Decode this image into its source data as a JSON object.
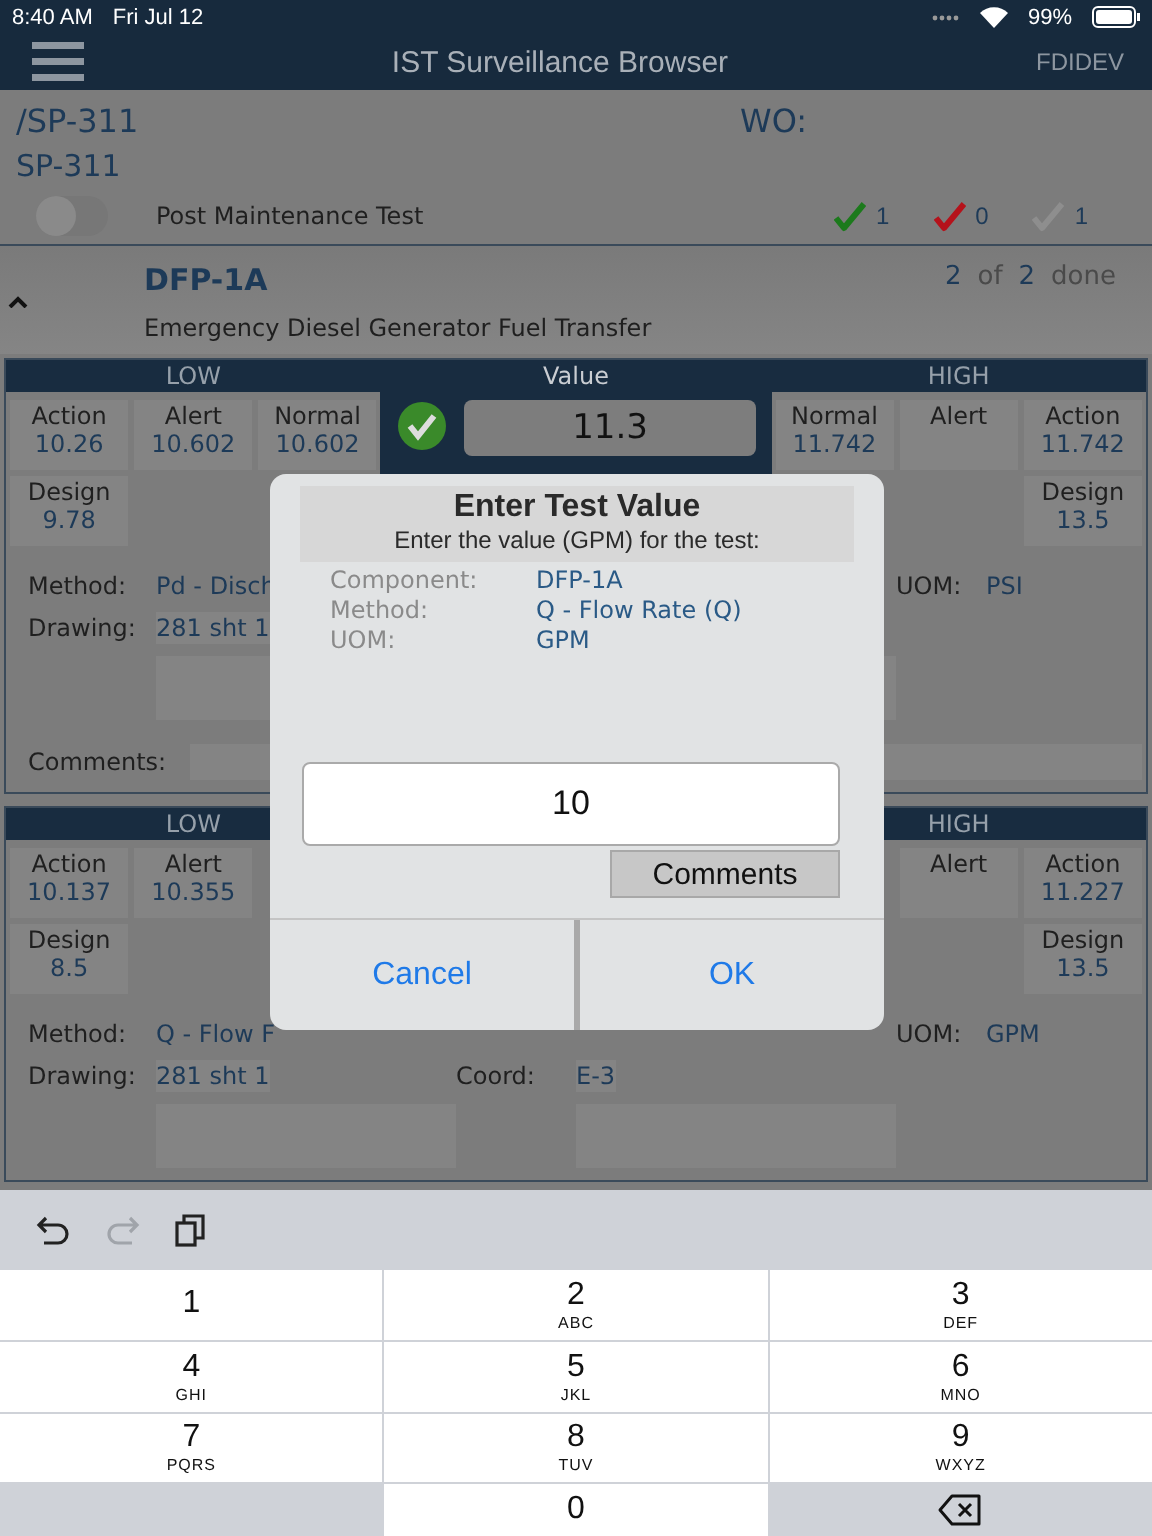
{
  "status_bar": {
    "time": "8:40 AM",
    "date": "Fri Jul 12",
    "battery": "99%"
  },
  "nav_bar": {
    "title": "IST Surveillance Browser",
    "environment": "FDIDEV"
  },
  "procedure": {
    "path": "/SP-311",
    "name": "SP-311",
    "wo_label": "WO:",
    "toggle": {
      "label": "Post Maintenance Test",
      "on": false
    },
    "counts": [
      {
        "kind": "passed",
        "count": "1"
      },
      {
        "kind": "failed",
        "count": "0"
      },
      {
        "kind": "pending",
        "count": "1"
      }
    ]
  },
  "component": {
    "expanded": true,
    "id": "DFP-1A",
    "done": "2",
    "of_label": "of",
    "total": "2",
    "done_label": "done",
    "description": "Emergency Diesel Generator Fuel Transfer"
  },
  "tests": [
    {
      "low_header": "LOW",
      "value_header": "Value",
      "high_header": "HIGH",
      "low": [
        {
          "label": "Action",
          "value": "10.26"
        },
        {
          "label": "Alert",
          "value": "10.602"
        },
        {
          "label": "Normal",
          "value": "10.602"
        }
      ],
      "low_design": {
        "label": "Design",
        "value": "9.78"
      },
      "value": "11.3",
      "passed": true,
      "high": [
        {
          "label": "Normal",
          "value": "11.742"
        },
        {
          "label": "Alert"
        },
        {
          "label": "Action",
          "value": "11.742"
        }
      ],
      "high_design": {
        "label": "Design",
        "value": "13.5"
      },
      "details": [
        {
          "left": {
            "label": "Method:",
            "value": "Pd - Disch"
          },
          "right": {
            "label": "UOM:",
            "value": "PSI"
          }
        },
        {
          "left": {
            "label": "Drawing:",
            "value": "281  sht 1"
          }
        }
      ],
      "comments_label": "Comments:"
    },
    {
      "low_header": "LOW",
      "high_header": "HIGH",
      "low": [
        {
          "label": "Action",
          "value": "10.137"
        },
        {
          "label": "Alert",
          "value": "10.355"
        }
      ],
      "low_design": {
        "label": "Design",
        "value": "8.5"
      },
      "high": [
        {
          "label": "Alert"
        },
        {
          "label": "Action",
          "value": "11.227"
        }
      ],
      "high_design": {
        "label": "Design",
        "value": "13.5"
      },
      "details": [
        {
          "left": {
            "label": "Method:",
            "value": "Q - Flow F"
          },
          "right": {
            "label": "UOM:",
            "value": "GPM"
          }
        },
        {
          "left": {
            "label": "Drawing:",
            "value": "281  sht 1"
          },
          "middle": {
            "label": "Coord:",
            "value": "E-3"
          }
        }
      ]
    }
  ],
  "dialog": {
    "title": "Enter Test Value",
    "subtitle": "Enter the value (GPM) for the test:",
    "info": [
      {
        "label": "Component:",
        "value": "DFP-1A"
      },
      {
        "label": "Method:",
        "value": "Q - Flow Rate (Q)"
      },
      {
        "label": "UOM:",
        "value": "GPM"
      }
    ],
    "input_value": "10",
    "comments_button": "Comments",
    "buttons": [
      "Cancel",
      "OK"
    ]
  },
  "keyboard": {
    "toolbar": [
      {
        "kind": "undo",
        "disabled": false
      },
      {
        "kind": "redo",
        "disabled": true
      },
      {
        "kind": "paste",
        "disabled": false
      }
    ],
    "keys": [
      {
        "kind": "digit",
        "digit": "1"
      },
      {
        "kind": "digit",
        "digit": "2",
        "letters": "ABC"
      },
      {
        "kind": "digit",
        "digit": "3",
        "letters": "DEF"
      },
      {
        "kind": "digit",
        "digit": "4",
        "letters": "GHI"
      },
      {
        "kind": "digit",
        "digit": "5",
        "letters": "JKL"
      },
      {
        "kind": "digit",
        "digit": "6",
        "letters": "MNO"
      },
      {
        "kind": "digit",
        "digit": "7",
        "letters": "PQRS"
      },
      {
        "kind": "digit",
        "digit": "8",
        "letters": "TUV"
      },
      {
        "kind": "digit",
        "digit": "9",
        "letters": "WXYZ"
      },
      {
        "kind": "blank"
      },
      {
        "kind": "digit",
        "digit": "0"
      },
      {
        "kind": "delete"
      }
    ]
  }
}
